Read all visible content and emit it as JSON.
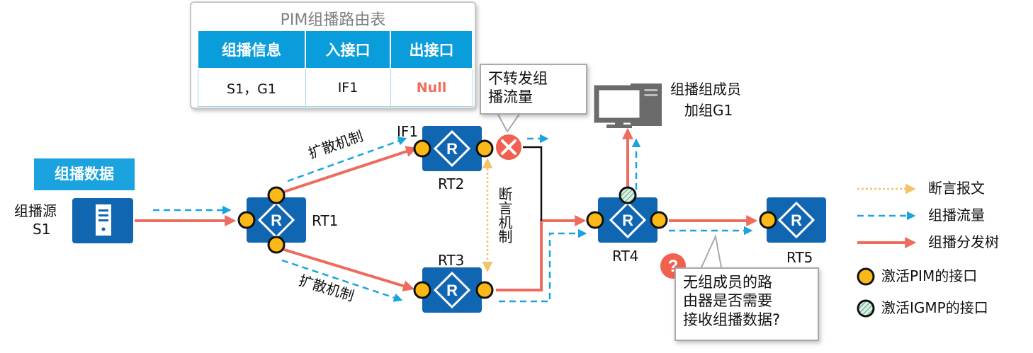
{
  "table": {
    "title": "PIM组播路由表",
    "headers": [
      "组播信息",
      "入接口",
      "出接口"
    ],
    "row": [
      "S1，G1",
      "IF1",
      "Null"
    ]
  },
  "source": {
    "tag": "组播数据",
    "label_line1": "组播源",
    "label_line2": "S1"
  },
  "routers": {
    "rt1": "RT1",
    "rt2": "RT2",
    "rt3": "RT3",
    "rt4": "RT4",
    "rt5": "RT5"
  },
  "labels": {
    "if1": "IF1",
    "flood_upper": "扩散机制",
    "flood_lower": "扩散机制",
    "assert": "断言机制"
  },
  "callout_stop": {
    "line1": "不转发组",
    "line2": "播流量"
  },
  "member": {
    "line1": "组播组成员",
    "line2": "加组G1"
  },
  "callout_question": {
    "line1": "无组成员的路",
    "line2": "由器是否需要",
    "line3": "接收组播数据?"
  },
  "legend": {
    "assert_msg": "断言报文",
    "mcast_flow": "组播流量",
    "dist_tree": "组播分发树",
    "pim_iface": "激活PIM的接口",
    "igmp_iface": "激活IGMP的接口"
  },
  "colors": {
    "router_blue": "#1166b1",
    "tree_red": "#ee6b5f",
    "flow_blue": "#1aa3de",
    "assert_yellow": "#f5c46a",
    "pim_yellow": "#fbb917",
    "x_red": "#f06150",
    "tag_blue": "#1aa3de"
  },
  "icons": [
    "server-icon",
    "router-icon",
    "pc-icon",
    "stop-x-icon",
    "question-icon",
    "igmp-hatch-icon"
  ]
}
